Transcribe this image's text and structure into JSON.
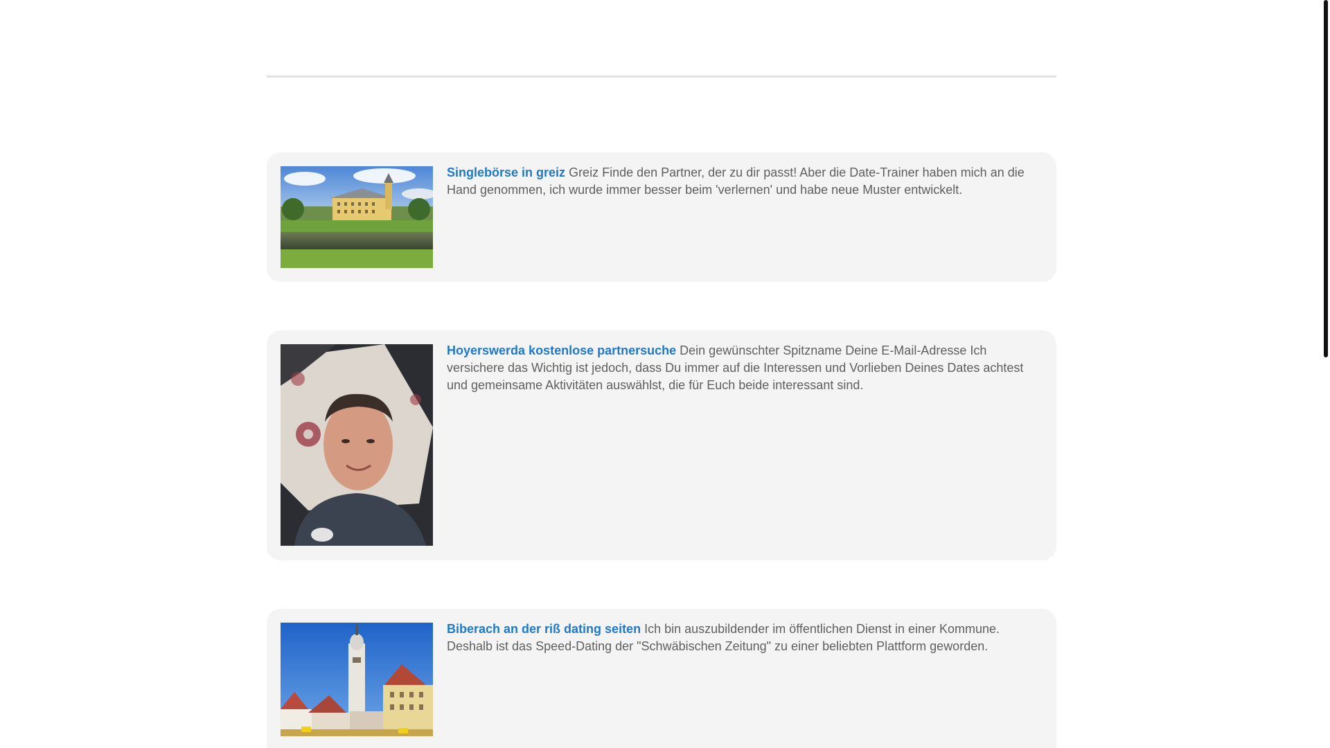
{
  "posts": [
    {
      "title": "Singlebörse in greiz",
      "body": "Greiz Finde den Partner, der zu dir passt! Aber die Date-Trainer haben mich an die Hand genommen, ich wurde immer besser beim 'verlernen' und habe neue Muster entwickelt."
    },
    {
      "title": "Hoyerswerda kostenlose partnersuche",
      "body": "Dein gewünschter Spitzname Deine E-Mail-Adresse Ich versichere das Wichtig ist jedoch, dass Du immer auf die Interessen und Vorlieben Deines Dates achtest und gemeinsame Aktivitäten auswählst, die für Euch beide interessant sind."
    },
    {
      "title": "Biberach an der riß dating seiten",
      "body": "Ich bin auszubildender im öffentlichen Dienst in einer Kommune. Deshalb ist das Speed-Dating der \"Schwäbischen Zeitung\" zu einer beliebten Plattform geworden."
    }
  ],
  "colors": {
    "link": "#1f78c8",
    "body_text": "#5f5f5f",
    "card_bg": "#f4f4f4"
  }
}
